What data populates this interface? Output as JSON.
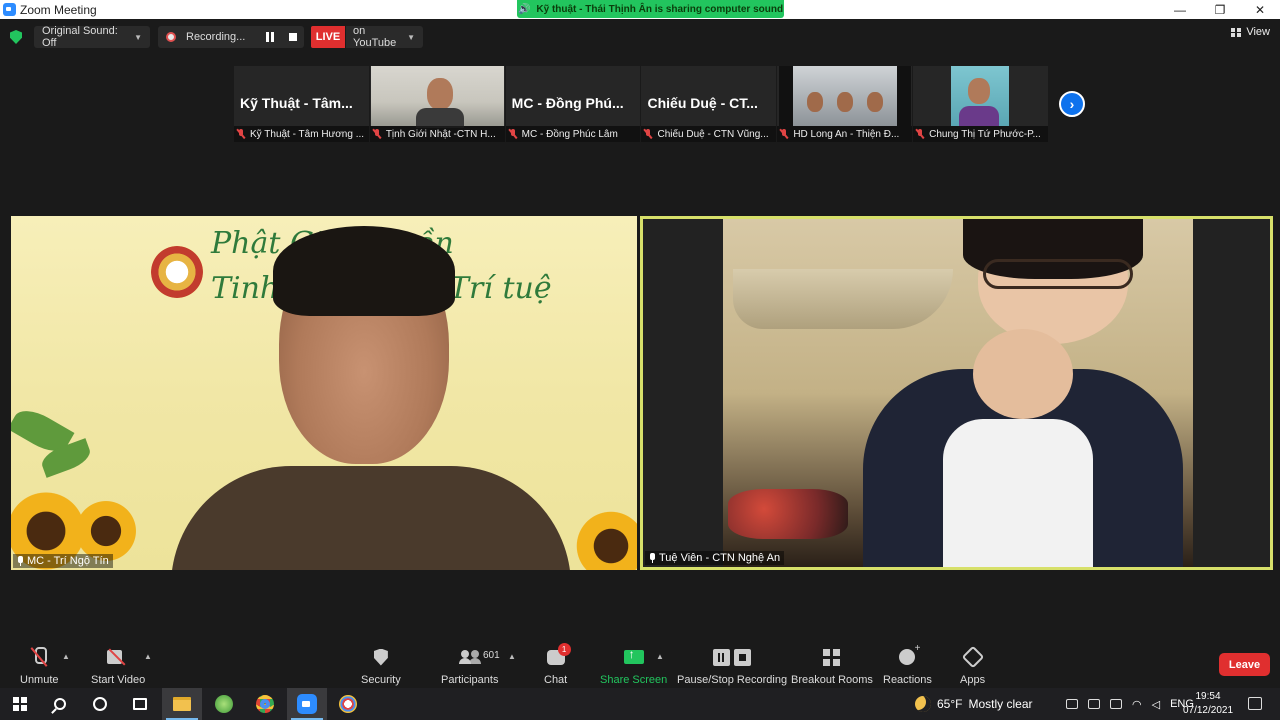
{
  "window": {
    "title": "Zoom Meeting",
    "sharing_banner": "Kỹ thuật - Thái Thịnh Ân is sharing computer sound",
    "controls": [
      "—",
      "❐",
      "✕"
    ]
  },
  "topbar": {
    "original_sound": "Original Sound: Off",
    "recording_label": "Recording...",
    "live_badge": "LIVE",
    "live_target": "on YouTube",
    "view_label": "View"
  },
  "thumbnails": [
    {
      "big_name": "Kỹ Thuật - Tâm...",
      "caption": "Kỹ Thuật - Tâm Hương ...",
      "video": false
    },
    {
      "big_name": "",
      "caption": "Tịnh Giới Nhật -CTN H...",
      "video": true
    },
    {
      "big_name": "MC - Đồng Phú...",
      "caption": "MC - Đồng Phúc Lâm",
      "video": false
    },
    {
      "big_name": "Chiếu Duệ - CT...",
      "caption": "Chiếu Duệ - CTN Vũng...",
      "video": false
    },
    {
      "big_name": "",
      "caption": "HD Long An - Thiện Đ...",
      "video": true
    },
    {
      "big_name": "",
      "caption": "Chung Thị Tứ Phước-P...",
      "video": true
    }
  ],
  "tiles": {
    "left": {
      "label": "MC - Trí Ngộ Tín",
      "banner_line1": "Phật Gi",
      "banner_line1_end": "ền",
      "banner_line2": "Tinh",
      "banner_line3": "Trí tuệ"
    },
    "right": {
      "label": "Tuệ Viên - CTN Nghệ An",
      "active_speaker_color": "#d7e06a"
    }
  },
  "toolbar": {
    "unmute": "Unmute",
    "start_video": "Start Video",
    "security": "Security",
    "participants": "Participants",
    "participants_count": "601",
    "chat": "Chat",
    "chat_badge": "1",
    "share_screen": "Share Screen",
    "pause_stop_recording": "Pause/Stop Recording",
    "breakout_rooms": "Breakout Rooms",
    "reactions": "Reactions",
    "apps": "Apps",
    "leave": "Leave"
  },
  "taskbar": {
    "weather_temp": "65°F",
    "weather_desc": "Mostly clear",
    "language": "ENG",
    "time": "19:54",
    "date": "07/12/2021"
  },
  "colors": {
    "zoom_blue": "#2d8cff",
    "live_red": "#e02f2f",
    "share_green": "#22c55e",
    "leave_red": "#e02f2f"
  }
}
